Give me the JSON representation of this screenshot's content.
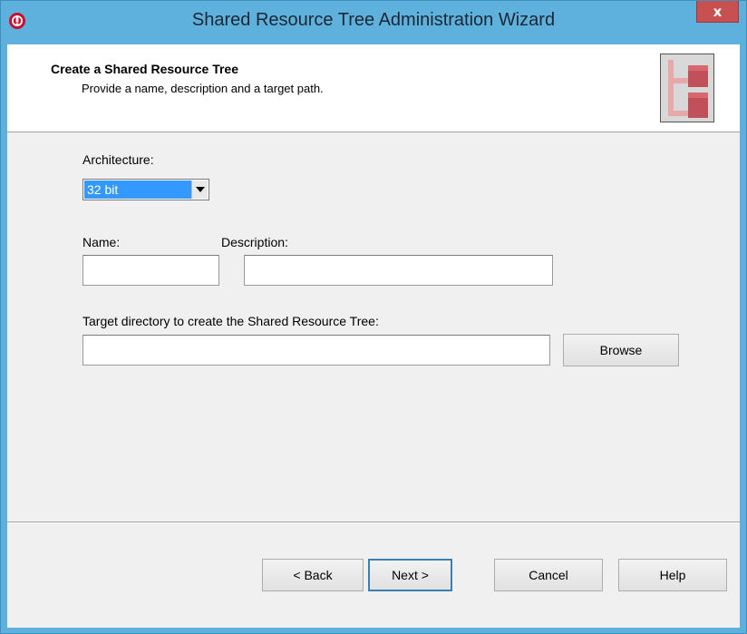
{
  "window": {
    "title": "Shared Resource Tree Administration Wizard",
    "close_label": "x",
    "app_icon": "red-circle-app-icon",
    "accent_color": "#5fb1dd"
  },
  "header": {
    "title": "Create a Shared Resource Tree",
    "subtitle": "Provide a name, description and a target path.",
    "logo_icon": "shared-resource-tree-icon"
  },
  "form": {
    "architecture": {
      "label": "Architecture:",
      "value": "32 bit"
    },
    "name": {
      "label": "Name:",
      "value": ""
    },
    "description": {
      "label": "Description:",
      "value": ""
    },
    "target": {
      "label": "Target directory to create the Shared Resource Tree:",
      "value": "",
      "browse_label": "Browse"
    }
  },
  "buttons": {
    "back": "< Back",
    "next": "Next >",
    "cancel": "Cancel",
    "help": "Help"
  }
}
